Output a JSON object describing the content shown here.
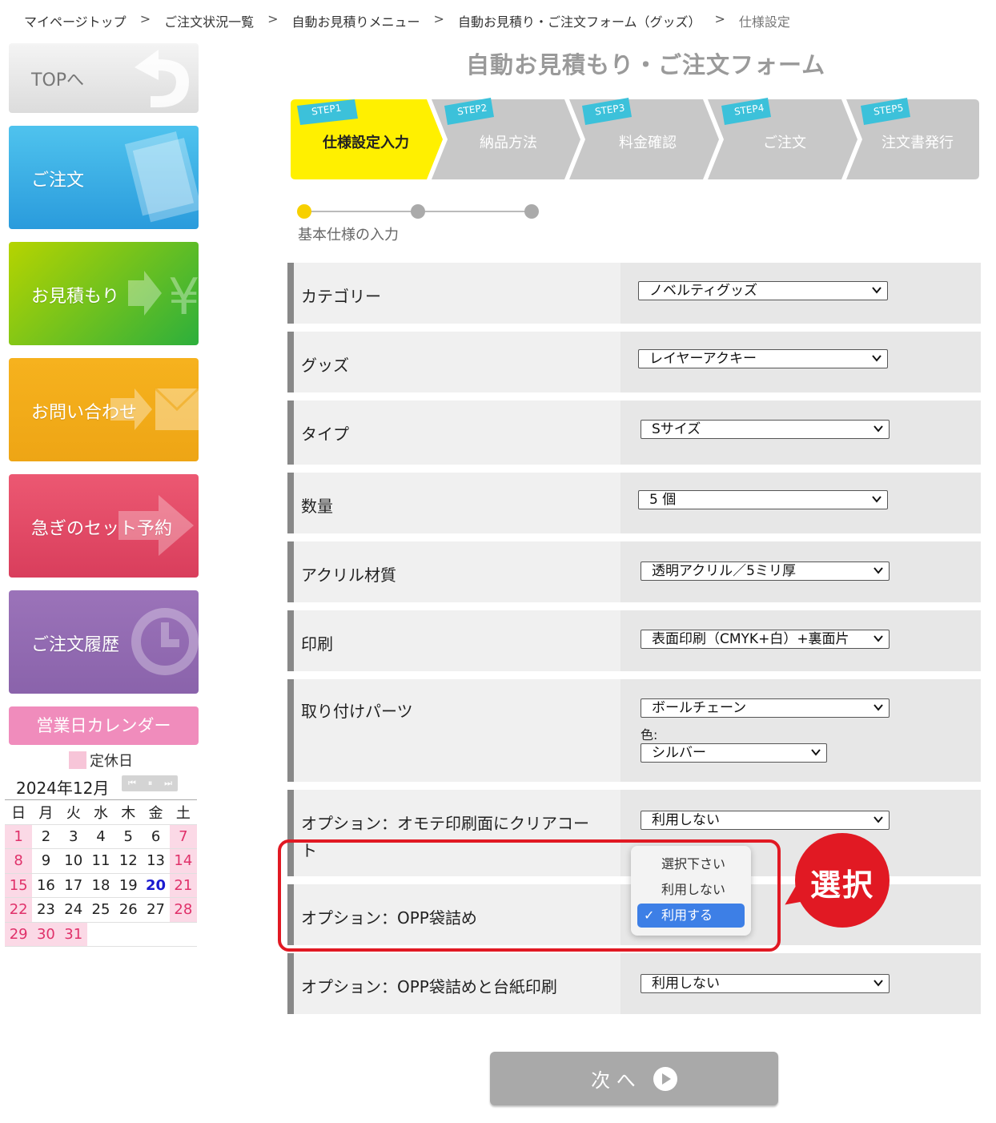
{
  "breadcrumb": {
    "items": [
      "マイページトップ",
      "ご注文状況一覧",
      "自動お見積りメニュー",
      "自動お見積り・ご注文フォーム（グッズ）",
      "仕様設定"
    ],
    "separator": ">"
  },
  "sidebar": {
    "top": "TOPへ",
    "order": "ご注文",
    "estimate": "お見積もり",
    "contact": "お問い合わせ",
    "rush": "急ぎのセット予約",
    "history": "ご注文履歴"
  },
  "calendar": {
    "title": "営業日カレンダー",
    "legend": "定休日",
    "month": "2024年12月",
    "nav": [
      "⏮",
      "⏸",
      "⏭"
    ],
    "weekdays": [
      "日",
      "月",
      "火",
      "水",
      "木",
      "金",
      "土"
    ],
    "weeks": [
      [
        "1",
        "2",
        "3",
        "4",
        "5",
        "6",
        "7"
      ],
      [
        "8",
        "9",
        "10",
        "11",
        "12",
        "13",
        "14"
      ],
      [
        "15",
        "16",
        "17",
        "18",
        "19",
        "20",
        "21"
      ],
      [
        "22",
        "23",
        "24",
        "25",
        "26",
        "27",
        "28"
      ],
      [
        "29",
        "30",
        "31",
        "",
        "",
        "",
        ""
      ]
    ],
    "today": "20"
  },
  "form": {
    "title": "自動お見積もり・ご注文フォーム",
    "steps": [
      {
        "tag": "STEP1",
        "label": "仕様設定入力"
      },
      {
        "tag": "STEP2",
        "label": "納品方法"
      },
      {
        "tag": "STEP3",
        "label": "料金確認"
      },
      {
        "tag": "STEP4",
        "label": "ご注文"
      },
      {
        "tag": "STEP5",
        "label": "注文書発行"
      }
    ],
    "progress_label": "基本仕様の入力",
    "rows": {
      "category": {
        "label": "カテゴリー",
        "value": "ノベルティグッズ"
      },
      "goods": {
        "label": "グッズ",
        "value": "レイヤーアクキー"
      },
      "type": {
        "label": "タイプ",
        "value": "Sサイズ"
      },
      "quantity": {
        "label": "数量",
        "value": "5 個"
      },
      "material": {
        "label": "アクリル材質",
        "value": "透明アクリル／5ミリ厚"
      },
      "print": {
        "label": "印刷",
        "value": "表面印刷（CMYK+白）+裏面片"
      },
      "parts": {
        "label": "取り付けパーツ",
        "value": "ボールチェーン",
        "color_label": "色:",
        "color_value": "シルバー"
      },
      "clearcoat": {
        "label_line1": "オプション：オモテ印刷面にクリアコー",
        "label_line2": "ト",
        "value": "利用しない"
      },
      "opp": {
        "label": "オプション：OPP袋詰め"
      },
      "opp_mount": {
        "label": "オプション：OPP袋詰めと台紙印刷",
        "value": "利用しない"
      }
    },
    "dropdown": {
      "options": [
        "選択下さい",
        "利用しない",
        "利用する"
      ],
      "selected": "利用する"
    },
    "callout": "選択",
    "next": "次 へ"
  },
  "colors": {
    "active_step": "#fff000",
    "inactive_step": "#c8c8c8",
    "step_tag": "#3cc1da",
    "highlight": "#e11923",
    "holiday": "#fbd9e6"
  }
}
